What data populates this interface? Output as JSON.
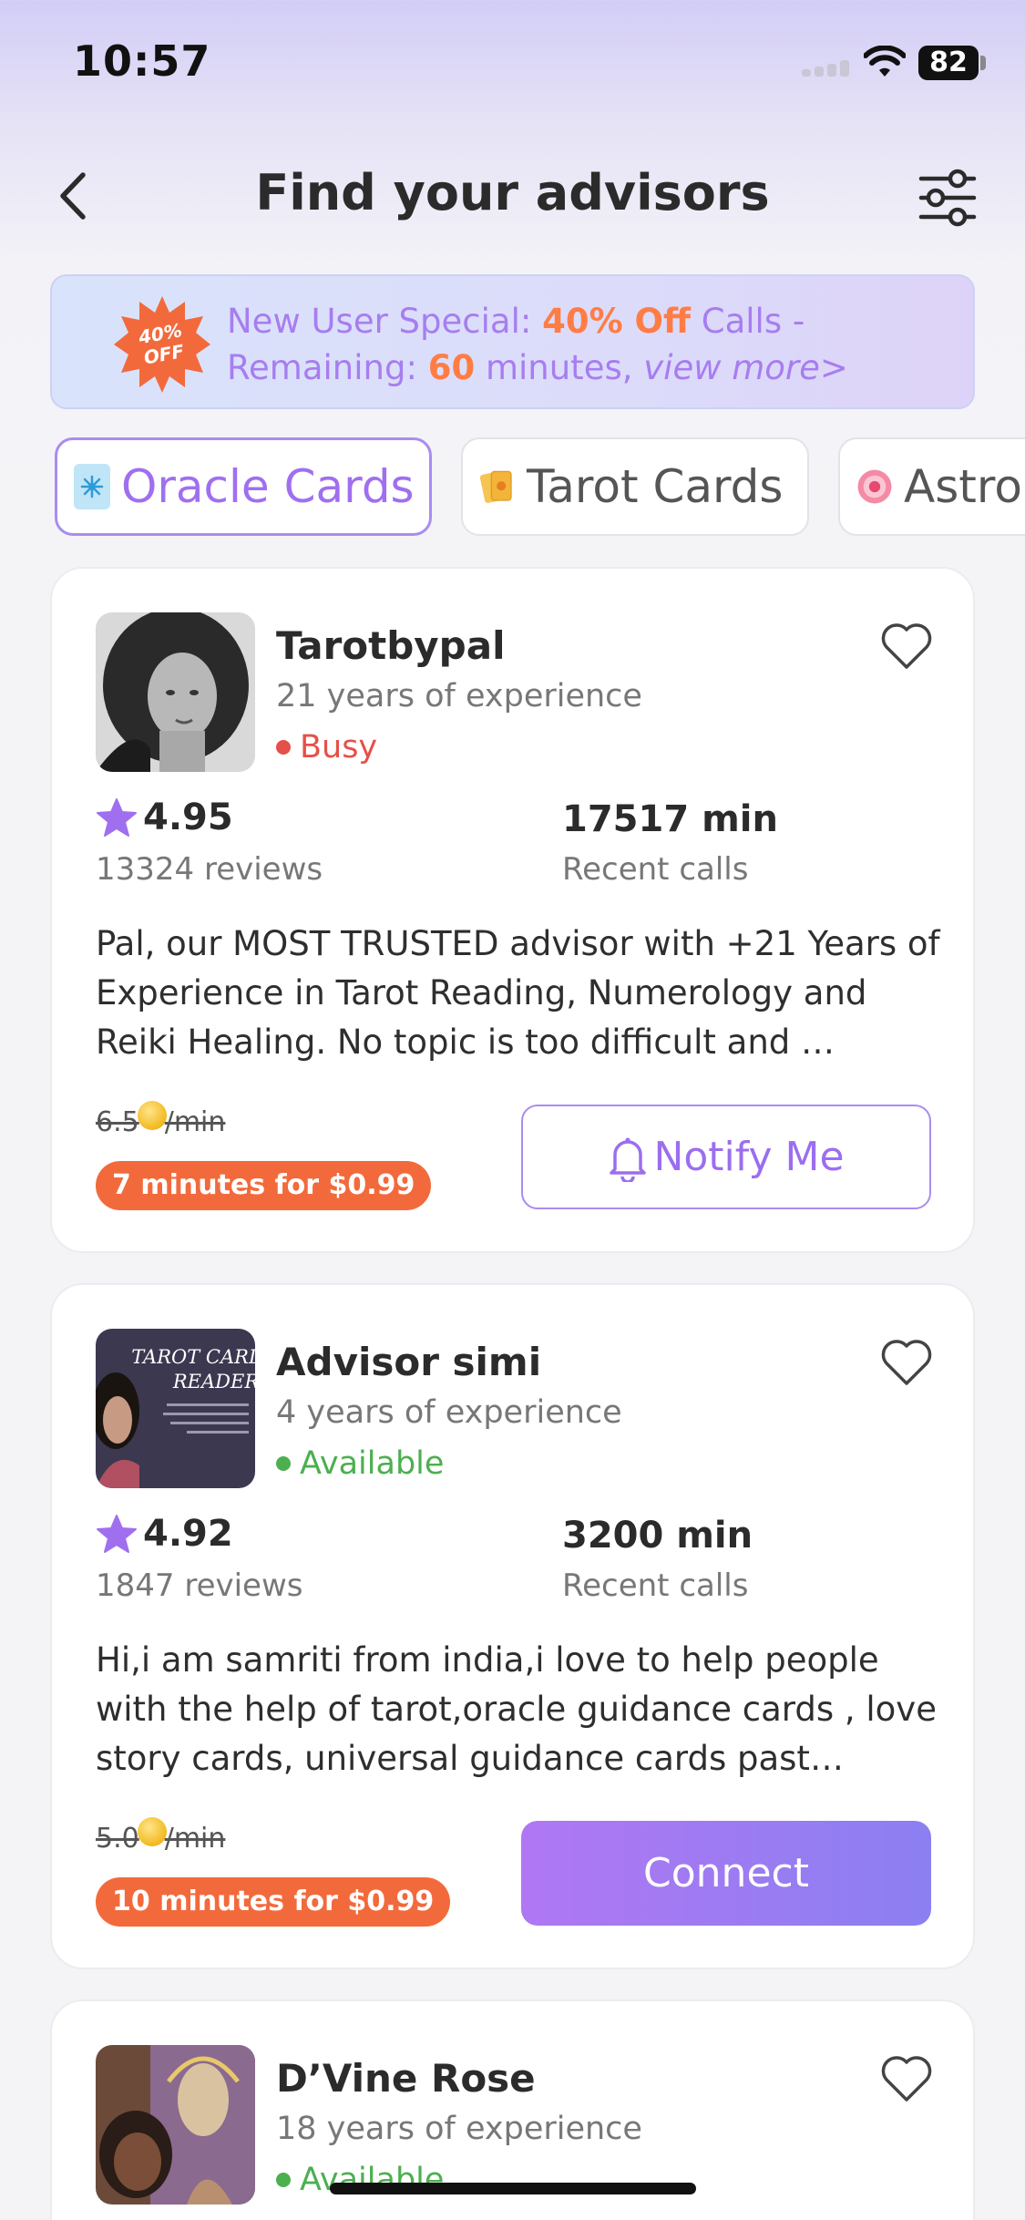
{
  "status_bar": {
    "time": "10:57",
    "battery": "82"
  },
  "header": {
    "title": "Find your advisors"
  },
  "promo": {
    "badge_pct": "40%",
    "badge_off": "OFF",
    "line1_prefix": "New User Special: ",
    "line1_highlight": "40% Off",
    "line1_suffix": " Calls -",
    "line2_prefix": "Remaining: ",
    "line2_highlight": "60",
    "line2_suffix": " minutes, ",
    "view_more": "view more>"
  },
  "categories": [
    {
      "label": "Oracle Cards",
      "active": true
    },
    {
      "label": "Tarot Cards",
      "active": false
    },
    {
      "label": "Astro",
      "active": false
    }
  ],
  "advisors": [
    {
      "name": "Tarotbypal",
      "experience": "21 years of experience",
      "status": "Busy",
      "rating": "4.95",
      "reviews": "13324 reviews",
      "minutes": "17517 min",
      "minutes_label": "Recent calls",
      "bio": "Pal, our MOST TRUSTED advisor with +21 Years of Experience in Tarot Reading, Numerology and Reiki Healing. No topic is too difficult and …",
      "price": "6.5",
      "price_unit": "/min",
      "deal": "7 minutes for $0.99",
      "action": "Notify Me"
    },
    {
      "name": "Advisor simi",
      "experience": "4 years of experience",
      "status": "Available",
      "rating": "4.92",
      "reviews": "1847 reviews",
      "minutes": "3200 min",
      "minutes_label": "Recent calls",
      "bio": "Hi,i am samriti from india,i love to help people with the help of tarot,oracle guidance cards , love story cards, universal guidance cards past…",
      "price": "5.0",
      "price_unit": "/min",
      "deal": "10 minutes for $0.99",
      "action": "Connect",
      "avatar_text1": "TAROT CARD",
      "avatar_text2": "READER"
    },
    {
      "name": "D’Vine Rose",
      "experience": "18 years of experience",
      "status": "Available"
    }
  ],
  "colors": {
    "accent": "#a06ff0",
    "orange": "#f26a3c",
    "busy": "#e6504a",
    "available": "#4caf50"
  }
}
